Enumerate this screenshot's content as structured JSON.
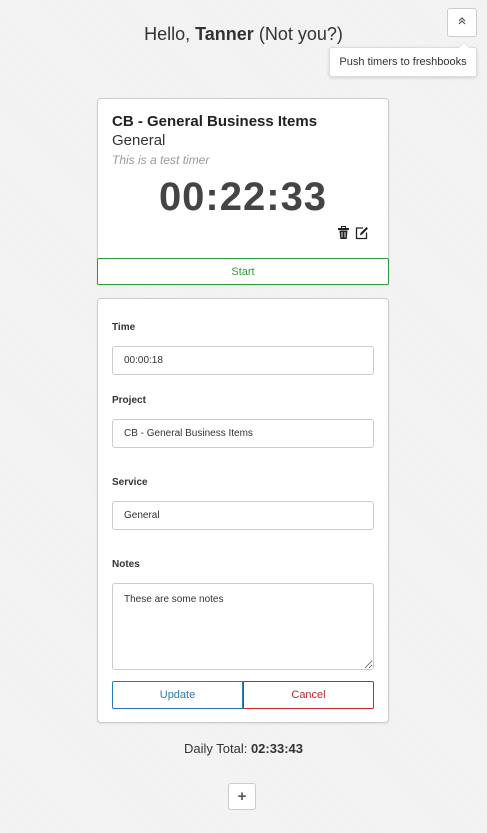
{
  "header": {
    "greeting_prefix": "Hello,",
    "user_name": "Tanner",
    "not_you": "(Not you?)",
    "push_button_icon": "chevron-double-up-icon",
    "push_tooltip": "Push timers to freshbooks"
  },
  "timer": {
    "project": "CB - General Business Items",
    "service": "General",
    "notes": "This is a test timer",
    "elapsed": "00:22:33",
    "start_label": "Start",
    "accent_color": "#2e9a3c"
  },
  "form": {
    "time_label": "Time",
    "time_value": "00:00:18",
    "project_label": "Project",
    "project_value": "CB - General Business Items",
    "service_label": "Service",
    "service_value": "General",
    "notes_label": "Notes",
    "notes_value": "These are some notes",
    "update_label": "Update",
    "cancel_label": "Cancel",
    "update_color": "#2a7bb0",
    "cancel_color": "#c0282d"
  },
  "footer": {
    "daily_total_label": "Daily Total:",
    "daily_total_value": "02:33:43",
    "add_label": "+"
  }
}
